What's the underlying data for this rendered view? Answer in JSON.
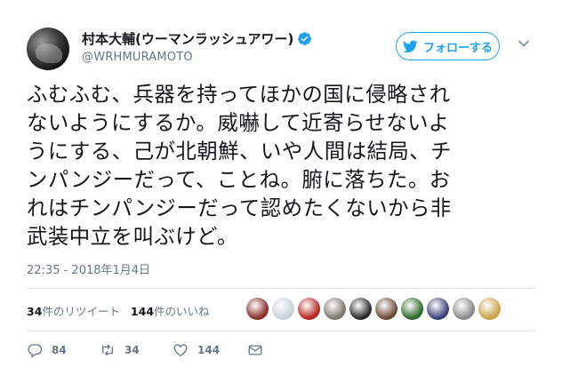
{
  "author": {
    "name": "村本大輔(ウーマンラッシュアワー)",
    "handle": "@WRHMURAMOTO"
  },
  "follow_button": {
    "label": "フォローする"
  },
  "tweet": {
    "lines": [
      "ふむふむ、兵器を持ってほかの国に侵略され",
      "ないようにするか。威嚇して近寄らせないよ",
      "うにする、己が北朝鮮、いや人間は結局、チ",
      "ンパンジーだって、ことね。腑に落ちた。お",
      "れはチンパンジーだって認めたくないから非",
      "武装中立を叫ぶけど。"
    ],
    "timestamp": "22:35 - 2018年1月4日"
  },
  "stats": {
    "retweets_count": "34",
    "retweets_label": "件のリツイート",
    "likes_count": "144",
    "likes_label": "件のいいね"
  },
  "liker_avatars": [
    {
      "color": "#8b2a2a"
    },
    {
      "color": "#c7d1d8"
    },
    {
      "color": "#b5261e"
    },
    {
      "color": "#7d766e"
    },
    {
      "color": "#2b2b2b"
    },
    {
      "color": "#6b4a3a"
    },
    {
      "color": "#2d6b2d"
    },
    {
      "color": "#3a3f7a"
    },
    {
      "color": "#8a8a8a"
    },
    {
      "color": "#c9a24a"
    }
  ],
  "actions": {
    "reply_count": "84",
    "retweet_count": "34",
    "like_count": "144"
  },
  "colors": {
    "accent": "#1da1f2",
    "text": "#14171a",
    "muted": "#657786",
    "divider": "#e6ecf0"
  }
}
